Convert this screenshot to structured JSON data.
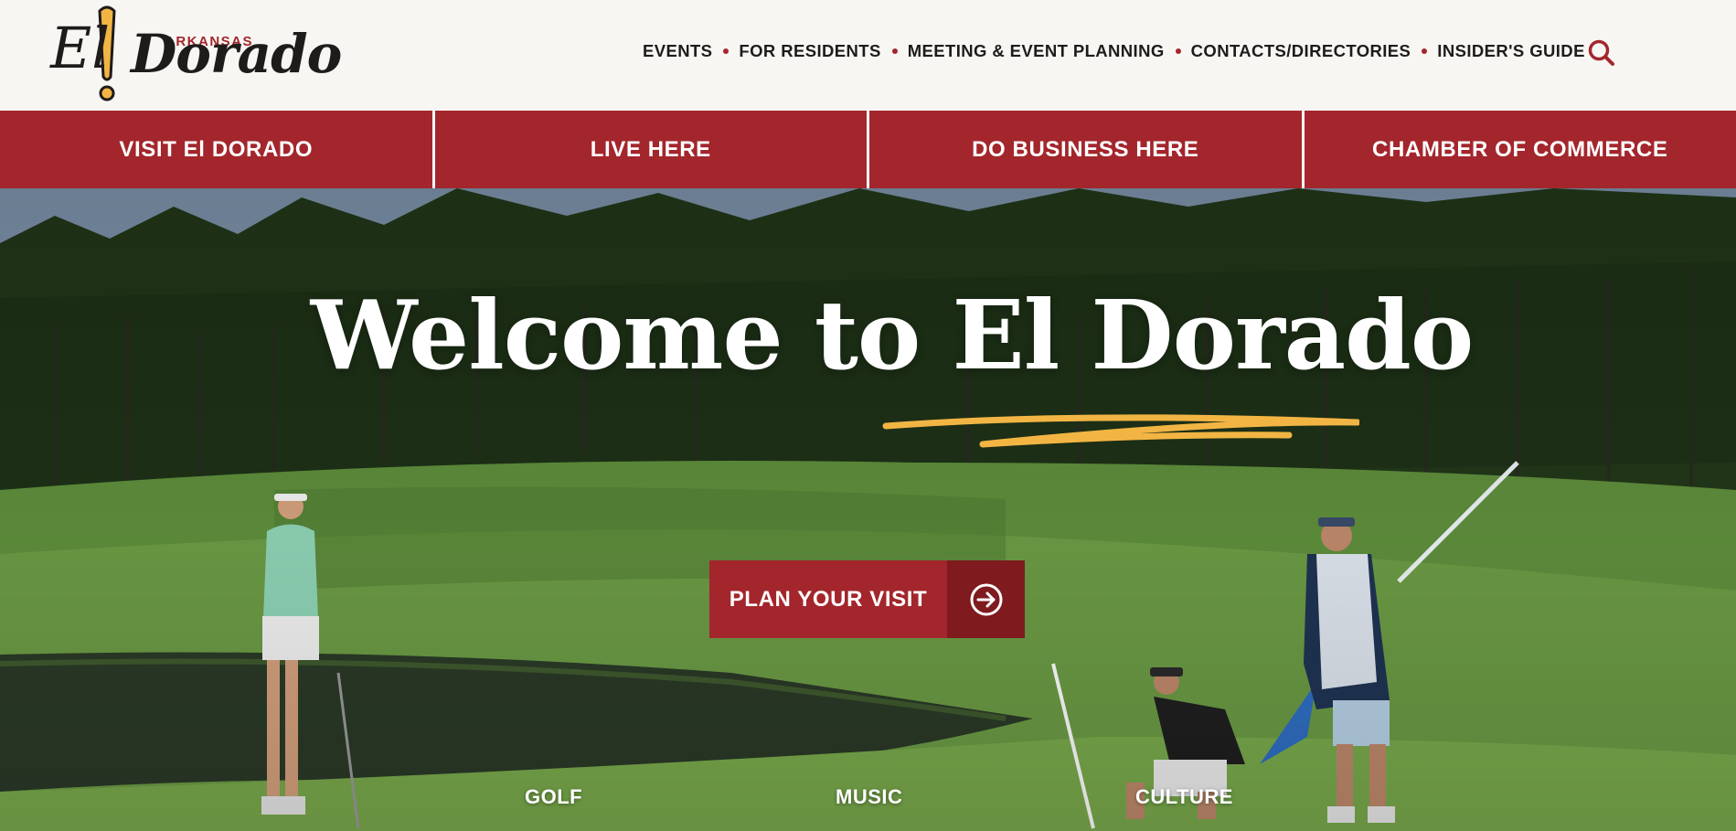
{
  "logo": {
    "state": "ARKANSAS",
    "part1": "El",
    "part2": "Dorado"
  },
  "topnav": {
    "items": [
      {
        "label": "EVENTS"
      },
      {
        "label": "FOR RESIDENTS"
      },
      {
        "label": "MEETING & EVENT PLANNING"
      },
      {
        "label": "CONTACTS/DIRECTORIES"
      },
      {
        "label": "INSIDER'S GUIDE"
      }
    ],
    "search_icon": "search-icon"
  },
  "mainnav": {
    "items": [
      {
        "label": "VISIT El DORADO"
      },
      {
        "label": "LIVE HERE"
      },
      {
        "label": "DO BUSINESS HERE"
      },
      {
        "label": "CHAMBER OF COMMERCE"
      }
    ]
  },
  "hero": {
    "title": "Welcome to El Dorado",
    "cta_label": "PLAN YOUR VISIT",
    "cta_icon": "arrow-right-circle-icon",
    "categories": [
      {
        "label": "GOLF"
      },
      {
        "label": "MUSIC"
      },
      {
        "label": "CULTURE"
      }
    ]
  },
  "colors": {
    "brand_red": "#a3262c",
    "brand_red_dark": "#7f1a1f",
    "accent_yellow": "#f2b544",
    "header_bg": "#f7f6f3",
    "text_dark": "#1f1b1a"
  }
}
